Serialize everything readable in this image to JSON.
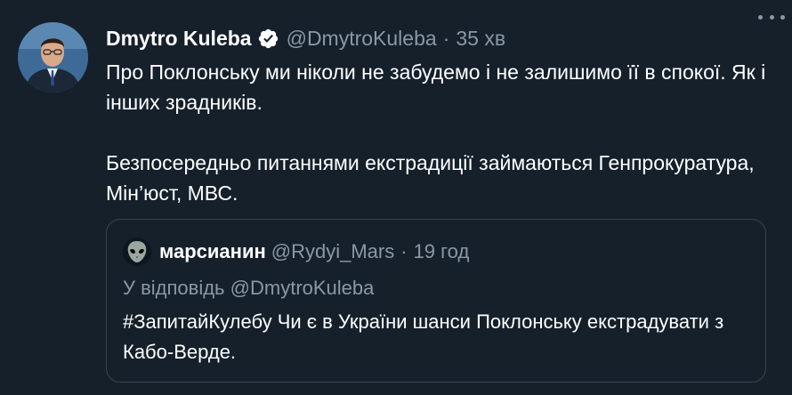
{
  "author": {
    "name": "Dmytro Kuleba",
    "handle": "@DmytroKuleba",
    "separator": "·",
    "time": "35 хв"
  },
  "tweet": {
    "paragraphs": [
      "Про Поклонську ми ніколи не забудемо і не залишимо її в спокої. Як і інших зрадників.",
      "Безпосередньо питаннями екстрадиції займаються Генпрокуратура, Мін’юст, МВС."
    ]
  },
  "quote": {
    "name": "марсианин",
    "handle": "@Rydyi_Mars",
    "separator": "·",
    "time": "19 год",
    "reply_prefix": "У відповідь",
    "reply_to": "@DmytroKuleba",
    "text": "#ЗапитайКулебу Чи є в України шанси Поклонську екстрадувати з Кабо-Верде."
  },
  "colors": {
    "background": "#15202b",
    "secondary_text": "#8b98a5",
    "verified_badge": "#ffffff",
    "border": "#38444d"
  },
  "icons": {
    "verified": "verified-badge-icon",
    "more": "more-options-icon"
  }
}
